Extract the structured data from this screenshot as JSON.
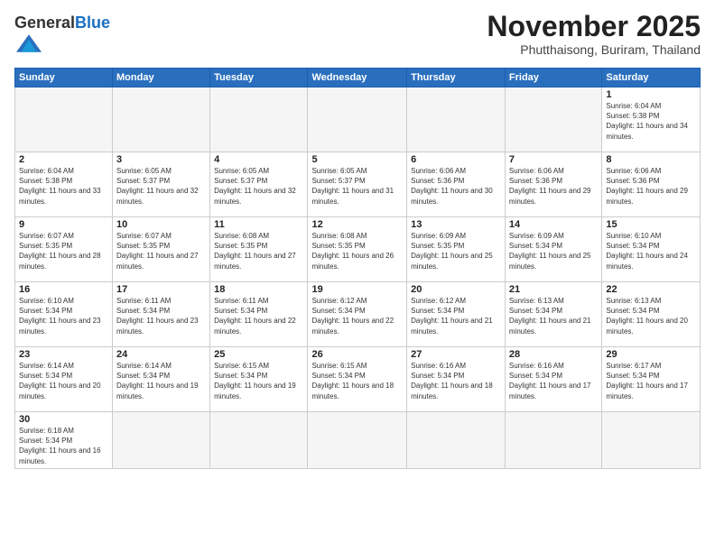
{
  "header": {
    "logo_general": "General",
    "logo_blue": "Blue",
    "month_title": "November 2025",
    "location": "Phutthaisong, Buriram, Thailand"
  },
  "weekdays": [
    "Sunday",
    "Monday",
    "Tuesday",
    "Wednesday",
    "Thursday",
    "Friday",
    "Saturday"
  ],
  "weeks": [
    [
      {
        "day": "",
        "empty": true
      },
      {
        "day": "",
        "empty": true
      },
      {
        "day": "",
        "empty": true
      },
      {
        "day": "",
        "empty": true
      },
      {
        "day": "",
        "empty": true
      },
      {
        "day": "",
        "empty": true
      },
      {
        "day": "1",
        "sunrise": "6:04 AM",
        "sunset": "5:38 PM",
        "daylight": "11 hours and 34 minutes."
      }
    ],
    [
      {
        "day": "2",
        "sunrise": "6:04 AM",
        "sunset": "5:38 PM",
        "daylight": "11 hours and 33 minutes."
      },
      {
        "day": "3",
        "sunrise": "6:05 AM",
        "sunset": "5:37 PM",
        "daylight": "11 hours and 32 minutes."
      },
      {
        "day": "4",
        "sunrise": "6:05 AM",
        "sunset": "5:37 PM",
        "daylight": "11 hours and 32 minutes."
      },
      {
        "day": "5",
        "sunrise": "6:05 AM",
        "sunset": "5:37 PM",
        "daylight": "11 hours and 31 minutes."
      },
      {
        "day": "6",
        "sunrise": "6:06 AM",
        "sunset": "5:36 PM",
        "daylight": "11 hours and 30 minutes."
      },
      {
        "day": "7",
        "sunrise": "6:06 AM",
        "sunset": "5:36 PM",
        "daylight": "11 hours and 29 minutes."
      },
      {
        "day": "8",
        "sunrise": "6:06 AM",
        "sunset": "5:36 PM",
        "daylight": "11 hours and 29 minutes."
      }
    ],
    [
      {
        "day": "9",
        "sunrise": "6:07 AM",
        "sunset": "5:35 PM",
        "daylight": "11 hours and 28 minutes."
      },
      {
        "day": "10",
        "sunrise": "6:07 AM",
        "sunset": "5:35 PM",
        "daylight": "11 hours and 27 minutes."
      },
      {
        "day": "11",
        "sunrise": "6:08 AM",
        "sunset": "5:35 PM",
        "daylight": "11 hours and 27 minutes."
      },
      {
        "day": "12",
        "sunrise": "6:08 AM",
        "sunset": "5:35 PM",
        "daylight": "11 hours and 26 minutes."
      },
      {
        "day": "13",
        "sunrise": "6:09 AM",
        "sunset": "5:35 PM",
        "daylight": "11 hours and 25 minutes."
      },
      {
        "day": "14",
        "sunrise": "6:09 AM",
        "sunset": "5:34 PM",
        "daylight": "11 hours and 25 minutes."
      },
      {
        "day": "15",
        "sunrise": "6:10 AM",
        "sunset": "5:34 PM",
        "daylight": "11 hours and 24 minutes."
      }
    ],
    [
      {
        "day": "16",
        "sunrise": "6:10 AM",
        "sunset": "5:34 PM",
        "daylight": "11 hours and 23 minutes."
      },
      {
        "day": "17",
        "sunrise": "6:11 AM",
        "sunset": "5:34 PM",
        "daylight": "11 hours and 23 minutes."
      },
      {
        "day": "18",
        "sunrise": "6:11 AM",
        "sunset": "5:34 PM",
        "daylight": "11 hours and 22 minutes."
      },
      {
        "day": "19",
        "sunrise": "6:12 AM",
        "sunset": "5:34 PM",
        "daylight": "11 hours and 22 minutes."
      },
      {
        "day": "20",
        "sunrise": "6:12 AM",
        "sunset": "5:34 PM",
        "daylight": "11 hours and 21 minutes."
      },
      {
        "day": "21",
        "sunrise": "6:13 AM",
        "sunset": "5:34 PM",
        "daylight": "11 hours and 21 minutes."
      },
      {
        "day": "22",
        "sunrise": "6:13 AM",
        "sunset": "5:34 PM",
        "daylight": "11 hours and 20 minutes."
      }
    ],
    [
      {
        "day": "23",
        "sunrise": "6:14 AM",
        "sunset": "5:34 PM",
        "daylight": "11 hours and 20 minutes."
      },
      {
        "day": "24",
        "sunrise": "6:14 AM",
        "sunset": "5:34 PM",
        "daylight": "11 hours and 19 minutes."
      },
      {
        "day": "25",
        "sunrise": "6:15 AM",
        "sunset": "5:34 PM",
        "daylight": "11 hours and 19 minutes."
      },
      {
        "day": "26",
        "sunrise": "6:15 AM",
        "sunset": "5:34 PM",
        "daylight": "11 hours and 18 minutes."
      },
      {
        "day": "27",
        "sunrise": "6:16 AM",
        "sunset": "5:34 PM",
        "daylight": "11 hours and 18 minutes."
      },
      {
        "day": "28",
        "sunrise": "6:16 AM",
        "sunset": "5:34 PM",
        "daylight": "11 hours and 17 minutes."
      },
      {
        "day": "29",
        "sunrise": "6:17 AM",
        "sunset": "5:34 PM",
        "daylight": "11 hours and 17 minutes."
      }
    ],
    [
      {
        "day": "30",
        "sunrise": "6:18 AM",
        "sunset": "5:34 PM",
        "daylight": "11 hours and 16 minutes."
      },
      {
        "day": "",
        "empty": true
      },
      {
        "day": "",
        "empty": true
      },
      {
        "day": "",
        "empty": true
      },
      {
        "day": "",
        "empty": true
      },
      {
        "day": "",
        "empty": true
      },
      {
        "day": "",
        "empty": true
      }
    ]
  ],
  "labels": {
    "sunrise": "Sunrise:",
    "sunset": "Sunset:",
    "daylight": "Daylight:"
  }
}
